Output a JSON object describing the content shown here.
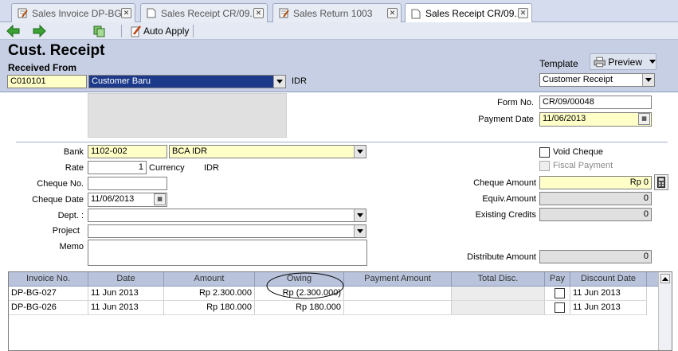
{
  "tabs": [
    {
      "label": "Sales Invoice DP-BG...",
      "active": false
    },
    {
      "label": "Sales Receipt CR/09...",
      "active": false
    },
    {
      "label": "Sales Return 1003",
      "active": false
    },
    {
      "label": "Sales Receipt CR/09...",
      "active": true
    }
  ],
  "toolbar": {
    "auto_apply_label": "Auto Apply"
  },
  "header": {
    "title": "Cust. Receipt",
    "received_from_label": "Received From",
    "template_label": "Template",
    "preview_label": "Preview",
    "customer_code": "C010101",
    "customer_name": "Customer Baru",
    "currency": "IDR",
    "template_value": "Customer Receipt"
  },
  "form": {
    "form_no_label": "Form No.",
    "form_no_value": "CR/09/00048",
    "payment_date_label": "Payment Date",
    "payment_date_value": "11/06/2013",
    "bank_label": "Bank",
    "bank_code": "1102-002",
    "bank_name": "BCA IDR",
    "rate_label": "Rate",
    "rate_value": "1",
    "currency_label": "Currency",
    "currency_value": "IDR",
    "cheque_no_label": "Cheque No.",
    "cheque_no_value": "",
    "cheque_date_label": "Cheque Date",
    "cheque_date_value": "11/06/2013",
    "dept_label": "Dept. :",
    "project_label": "Project",
    "memo_label": "Memo",
    "void_cheque_label": "Void Cheque",
    "fiscal_payment_label": "Fiscal Payment",
    "cheque_amount_label": "Cheque Amount",
    "cheque_amount_value": "Rp 0",
    "equiv_amount_label": "Equiv.Amount",
    "equiv_amount_value": "0",
    "existing_credits_label": "Existing Credits",
    "existing_credits_value": "0",
    "distribute_amount_label": "Distribute Amount",
    "distribute_amount_value": "0"
  },
  "grid": {
    "columns": [
      "Invoice No.",
      "Date",
      "Amount",
      "Owing",
      "Payment Amount",
      "Total Disc.",
      "Pay",
      "Discount Date"
    ],
    "rows": [
      {
        "invoice": "DP-BG-027",
        "date": "11 Jun 2013",
        "amount": "Rp 2.300.000",
        "owing": "Rp (2.300.000)",
        "payment": "",
        "disc": "",
        "pay": false,
        "disc_date": "11 Jun 2013"
      },
      {
        "invoice": "DP-BG-026",
        "date": "11 Jun 2013",
        "amount": "Rp 180.000",
        "owing": "Rp 180.000",
        "payment": "",
        "disc": "",
        "pay": false,
        "disc_date": "11 Jun 2013"
      }
    ]
  },
  "colors": {
    "accent_field": "#ffffc8",
    "selected_combo": "#1d3a8a",
    "header_band": "#c6cfe4"
  }
}
